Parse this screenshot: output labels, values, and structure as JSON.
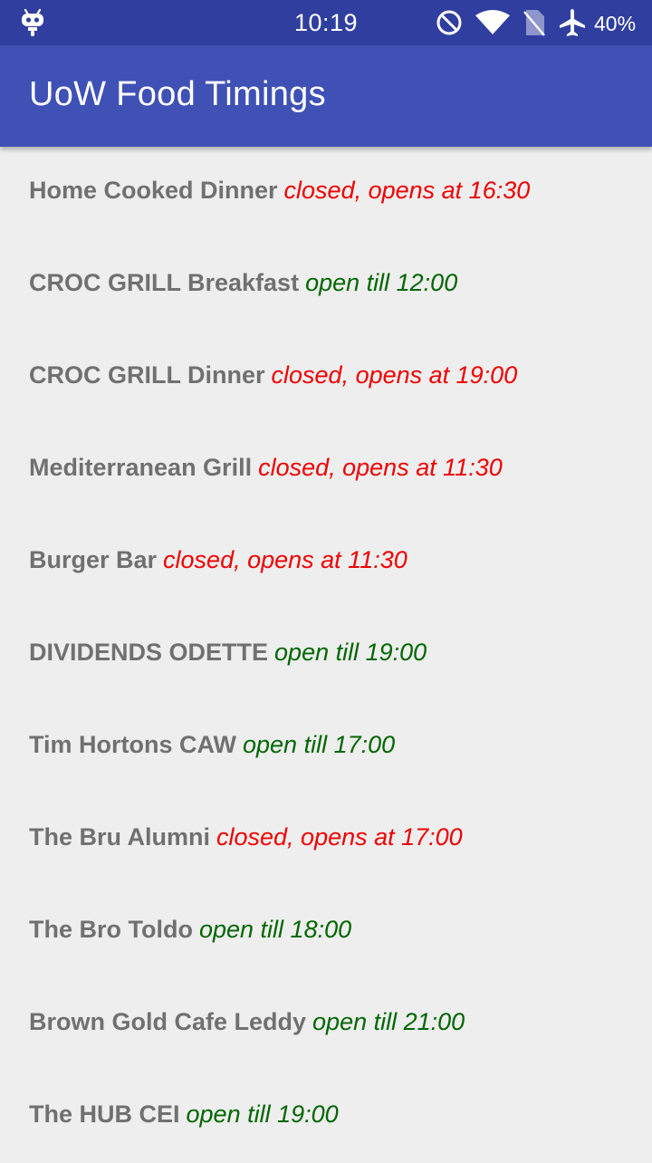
{
  "status_bar": {
    "time": "10:19",
    "battery": "40%",
    "icons": [
      "android-icon",
      "do-not-disturb-icon",
      "wifi-icon",
      "no-sim-icon",
      "airplane-mode-icon"
    ]
  },
  "app_bar": {
    "title": "UoW Food Timings"
  },
  "colors": {
    "status_bar": "#303f9f",
    "app_bar": "#3f51b5",
    "background": "#eeeeee",
    "name_text": "#707070",
    "closed": "#f00000",
    "open": "#006600"
  },
  "venues": [
    {
      "name": "Home Cooked Dinner",
      "status": "closed, opens at 16:30",
      "state": "closed"
    },
    {
      "name": "CROC GRILL Breakfast",
      "status": "open till 12:00",
      "state": "open"
    },
    {
      "name": "CROC GRILL Dinner",
      "status": "closed, opens at 19:00",
      "state": "closed"
    },
    {
      "name": "Mediterranean Grill",
      "status": "closed, opens at 11:30",
      "state": "closed"
    },
    {
      "name": "Burger Bar",
      "status": "closed, opens at 11:30",
      "state": "closed"
    },
    {
      "name": "DIVIDENDS ODETTE",
      "status": "open till 19:00",
      "state": "open"
    },
    {
      "name": "Tim Hortons CAW",
      "status": "open till 17:00",
      "state": "open"
    },
    {
      "name": "The Bru Alumni",
      "status": "closed, opens at 17:00",
      "state": "closed"
    },
    {
      "name": "The Bro Toldo",
      "status": "open till 18:00",
      "state": "open"
    },
    {
      "name": "Brown Gold Cafe Leddy",
      "status": "open till 21:00",
      "state": "open"
    },
    {
      "name": "The HUB CEI",
      "status": "open till 19:00",
      "state": "open"
    }
  ]
}
